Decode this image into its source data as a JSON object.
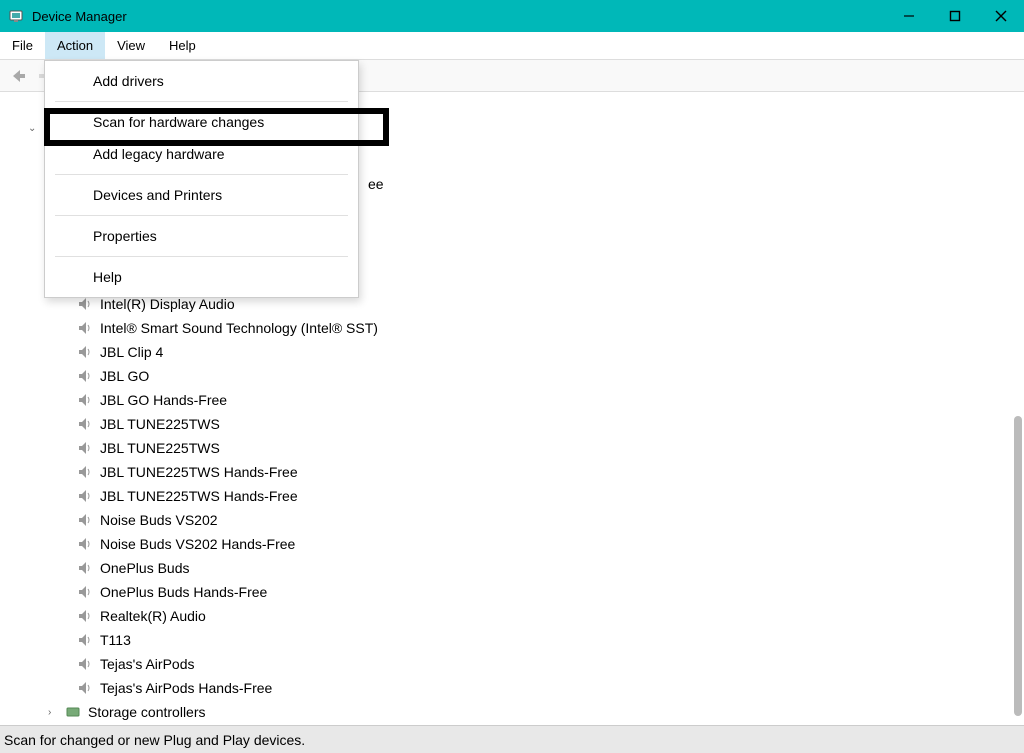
{
  "window": {
    "title": "Device Manager"
  },
  "menubar": {
    "items": [
      "File",
      "Action",
      "View",
      "Help"
    ],
    "activeIndex": 1
  },
  "actionMenu": {
    "items": [
      {
        "label": "Add drivers",
        "sepAfter": true
      },
      {
        "label": "Scan for hardware changes",
        "highlighted": true
      },
      {
        "label": "Add legacy hardware",
        "sepAfter": true
      },
      {
        "label": "Devices and Printers",
        "sepAfter": true
      },
      {
        "label": "Properties",
        "sepAfter": true
      },
      {
        "label": "Help"
      }
    ]
  },
  "tree": {
    "visiblePartialSuffix": "ee",
    "devices": [
      "Intel(R) Display Audio",
      "Intel® Smart Sound Technology (Intel® SST)",
      "JBL Clip 4",
      "JBL GO",
      "JBL GO Hands-Free",
      "JBL TUNE225TWS",
      "JBL TUNE225TWS",
      "JBL TUNE225TWS Hands-Free",
      "JBL TUNE225TWS Hands-Free",
      "Noise Buds VS202",
      "Noise Buds VS202 Hands-Free",
      "OnePlus Buds",
      "OnePlus Buds Hands-Free",
      "Realtek(R) Audio",
      "T113",
      "Tejas's AirPods",
      "Tejas's AirPods Hands-Free"
    ],
    "nextCategory": "Storage controllers"
  },
  "statusbar": {
    "text": "Scan for changed or new Plug and Play devices."
  }
}
